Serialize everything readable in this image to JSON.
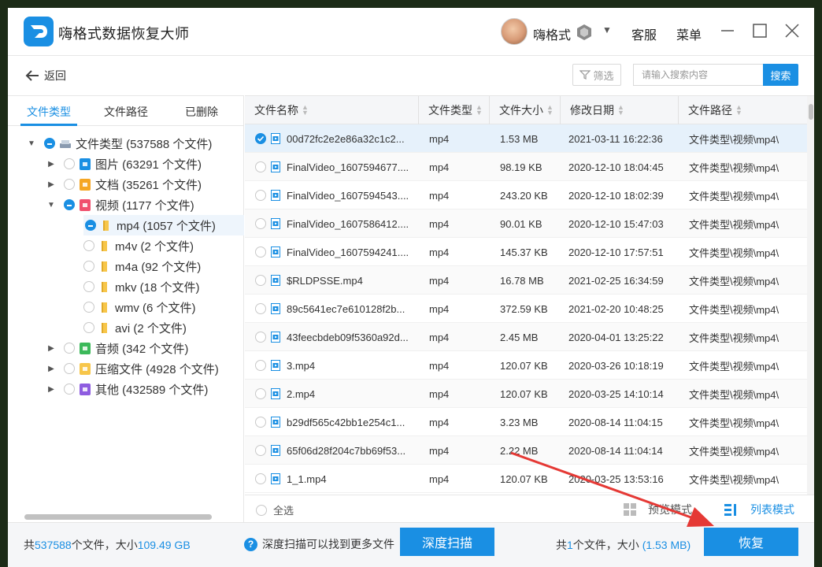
{
  "app": {
    "title": "嗨格式数据恢复大师",
    "username": "嗨格式",
    "links": {
      "service": "客服",
      "menu": "菜单"
    }
  },
  "toolbar": {
    "back_label": "返回",
    "filter_label": "筛选",
    "search_placeholder": "请输入搜索内容",
    "search_button": "搜索"
  },
  "sidebar": {
    "tabs": [
      {
        "label": "文件类型",
        "active": true
      },
      {
        "label": "文件路径",
        "active": false
      },
      {
        "label": "已删除",
        "active": false
      }
    ],
    "tree": [
      {
        "label": "文件类型 (537588 个文件)",
        "expander": "▼",
        "state": "partial",
        "icon": "drive-icon"
      },
      {
        "label": "图片 (63291 个文件)",
        "expander": "▶",
        "state": "none",
        "icon": "image-icon",
        "color": "#1a8fe3"
      },
      {
        "label": "文档 (35261 个文件)",
        "expander": "▶",
        "state": "none",
        "icon": "document-icon",
        "color": "#f5a623"
      },
      {
        "label": "视频 (1177 个文件)",
        "expander": "▼",
        "state": "partial",
        "icon": "video-icon",
        "color": "#f0506e"
      },
      {
        "label": "mp4 (1057 个文件)",
        "expander": "",
        "state": "partial",
        "icon": "folder-icon",
        "color": "#f7c64a",
        "selected": true
      },
      {
        "label": "m4v (2 个文件)",
        "expander": "",
        "state": "none",
        "icon": "folder-icon",
        "color": "#f7c64a"
      },
      {
        "label": "m4a (92 个文件)",
        "expander": "",
        "state": "none",
        "icon": "folder-icon",
        "color": "#f7c64a"
      },
      {
        "label": "mkv (18 个文件)",
        "expander": "",
        "state": "none",
        "icon": "folder-icon",
        "color": "#f7c64a"
      },
      {
        "label": "wmv (6 个文件)",
        "expander": "",
        "state": "none",
        "icon": "folder-icon",
        "color": "#f7c64a"
      },
      {
        "label": "avi (2 个文件)",
        "expander": "",
        "state": "none",
        "icon": "folder-icon",
        "color": "#f7c64a"
      },
      {
        "label": "音频 (342 个文件)",
        "expander": "▶",
        "state": "none",
        "icon": "audio-icon",
        "color": "#3cb95a"
      },
      {
        "label": "压缩文件 (4928 个文件)",
        "expander": "▶",
        "state": "none",
        "icon": "archive-icon",
        "color": "#f7c64a"
      },
      {
        "label": "其他 (432589 个文件)",
        "expander": "▶",
        "state": "none",
        "icon": "other-icon",
        "color": "#8e5ce0"
      }
    ]
  },
  "table": {
    "columns": [
      "文件名称",
      "文件类型",
      "文件大小",
      "修改日期",
      "文件路径"
    ],
    "rows": [
      {
        "name": "00d72fc2e2e86a32c1c2...",
        "type": "mp4",
        "size": "1.53 MB",
        "date": "2021-03-11 16:22:36",
        "path": "文件类型\\视频\\mp4\\",
        "checked": true
      },
      {
        "name": "FinalVideo_1607594677....",
        "type": "mp4",
        "size": "98.19 KB",
        "date": "2020-12-10 18:04:45",
        "path": "文件类型\\视频\\mp4\\",
        "checked": false
      },
      {
        "name": "FinalVideo_1607594543....",
        "type": "mp4",
        "size": "243.20 KB",
        "date": "2020-12-10 18:02:39",
        "path": "文件类型\\视频\\mp4\\",
        "checked": false
      },
      {
        "name": "FinalVideo_1607586412....",
        "type": "mp4",
        "size": "90.01 KB",
        "date": "2020-12-10 15:47:03",
        "path": "文件类型\\视频\\mp4\\",
        "checked": false
      },
      {
        "name": "FinalVideo_1607594241....",
        "type": "mp4",
        "size": "145.37 KB",
        "date": "2020-12-10 17:57:51",
        "path": "文件类型\\视频\\mp4\\",
        "checked": false
      },
      {
        "name": "$RLDPSSE.mp4",
        "type": "mp4",
        "size": "16.78 MB",
        "date": "2021-02-25 16:34:59",
        "path": "文件类型\\视频\\mp4\\",
        "checked": false
      },
      {
        "name": "89c5641ec7e610128f2b...",
        "type": "mp4",
        "size": "372.59 KB",
        "date": "2021-02-20 10:48:25",
        "path": "文件类型\\视频\\mp4\\",
        "checked": false
      },
      {
        "name": "43feecbdeb09f5360a92d...",
        "type": "mp4",
        "size": "2.45 MB",
        "date": "2020-04-01 13:25:22",
        "path": "文件类型\\视频\\mp4\\",
        "checked": false
      },
      {
        "name": "3.mp4",
        "type": "mp4",
        "size": "120.07 KB",
        "date": "2020-03-26 10:18:19",
        "path": "文件类型\\视频\\mp4\\",
        "checked": false
      },
      {
        "name": "2.mp4",
        "type": "mp4",
        "size": "120.07 KB",
        "date": "2020-03-25 14:10:14",
        "path": "文件类型\\视频\\mp4\\",
        "checked": false
      },
      {
        "name": "b29df565c42bb1e254c1...",
        "type": "mp4",
        "size": "3.23 MB",
        "date": "2020-08-14 11:04:15",
        "path": "文件类型\\视频\\mp4\\",
        "checked": false
      },
      {
        "name": "65f06d28f204c7bb69f53...",
        "type": "mp4",
        "size": "2.22 MB",
        "date": "2020-08-14 11:04:14",
        "path": "文件类型\\视频\\mp4\\",
        "checked": false
      },
      {
        "name": "1_1.mp4",
        "type": "mp4",
        "size": "120.07 KB",
        "date": "2020-03-25 13:53:16",
        "path": "文件类型\\视频\\mp4\\",
        "checked": false
      }
    ],
    "select_all_label": "全选",
    "preview_mode_label": "预览模式",
    "list_mode_label": "列表模式"
  },
  "footer": {
    "total_prefix": "共",
    "total_files": "537588",
    "total_mid": "个文件，大小",
    "total_size": "109.49 GB",
    "deep_hint": "深度扫描可以找到更多文件",
    "deep_button": "深度扫描",
    "sel_prefix": "共",
    "sel_count": "1",
    "sel_mid": "个文件，大小",
    "sel_size": "(1.53 MB)",
    "recover_button": "恢复"
  },
  "colors": {
    "accent": "#1a8fe3",
    "arrow": "#e53935"
  }
}
